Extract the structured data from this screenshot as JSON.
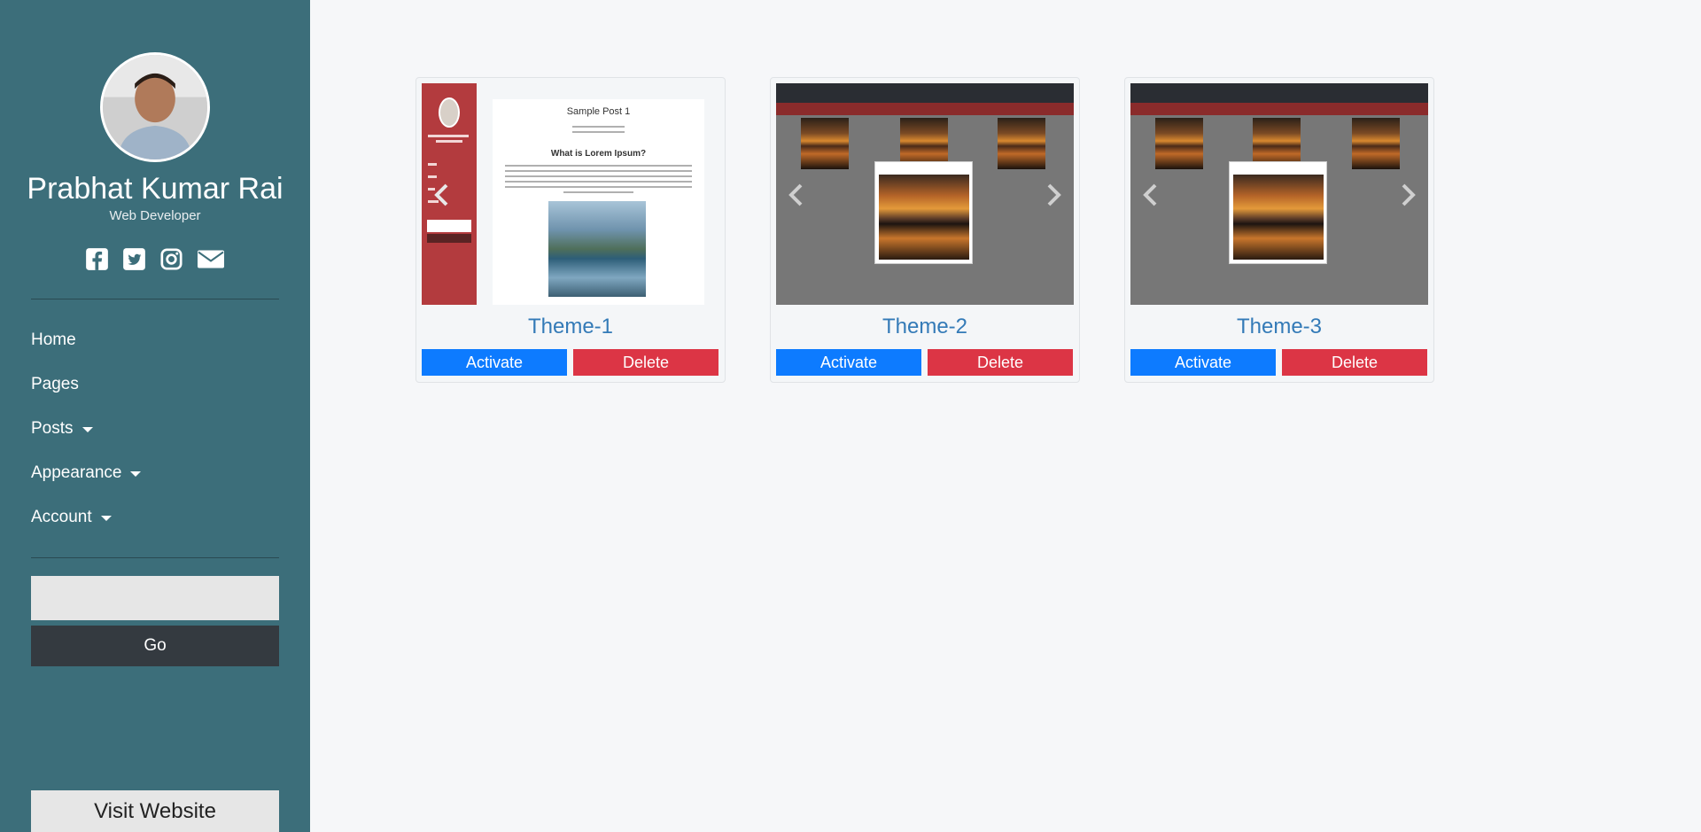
{
  "profile": {
    "name": "Prabhat Kumar Rai",
    "role": "Web Developer"
  },
  "socials": [
    "facebook-icon",
    "twitter-icon",
    "instagram-icon",
    "envelope-icon"
  ],
  "nav": {
    "home": "Home",
    "pages": "Pages",
    "posts": "Posts",
    "appearance": "Appearance",
    "account": "Account"
  },
  "search": {
    "value": "",
    "placeholder": "",
    "go_label": "Go"
  },
  "visit_label": "Visit Website",
  "themes": [
    {
      "title": "Theme-1",
      "activate": "Activate",
      "delete": "Delete"
    },
    {
      "title": "Theme-2",
      "activate": "Activate",
      "delete": "Delete"
    },
    {
      "title": "Theme-3",
      "activate": "Activate",
      "delete": "Delete"
    }
  ],
  "preview1": {
    "post_title": "Sample Post 1",
    "heading": "What is Lorem Ipsum?"
  },
  "colors": {
    "sidebar": "#3c6e7a",
    "activate": "#0d7bff",
    "delete": "#dc3545",
    "go": "#343a40",
    "title_link": "#337ab7"
  }
}
